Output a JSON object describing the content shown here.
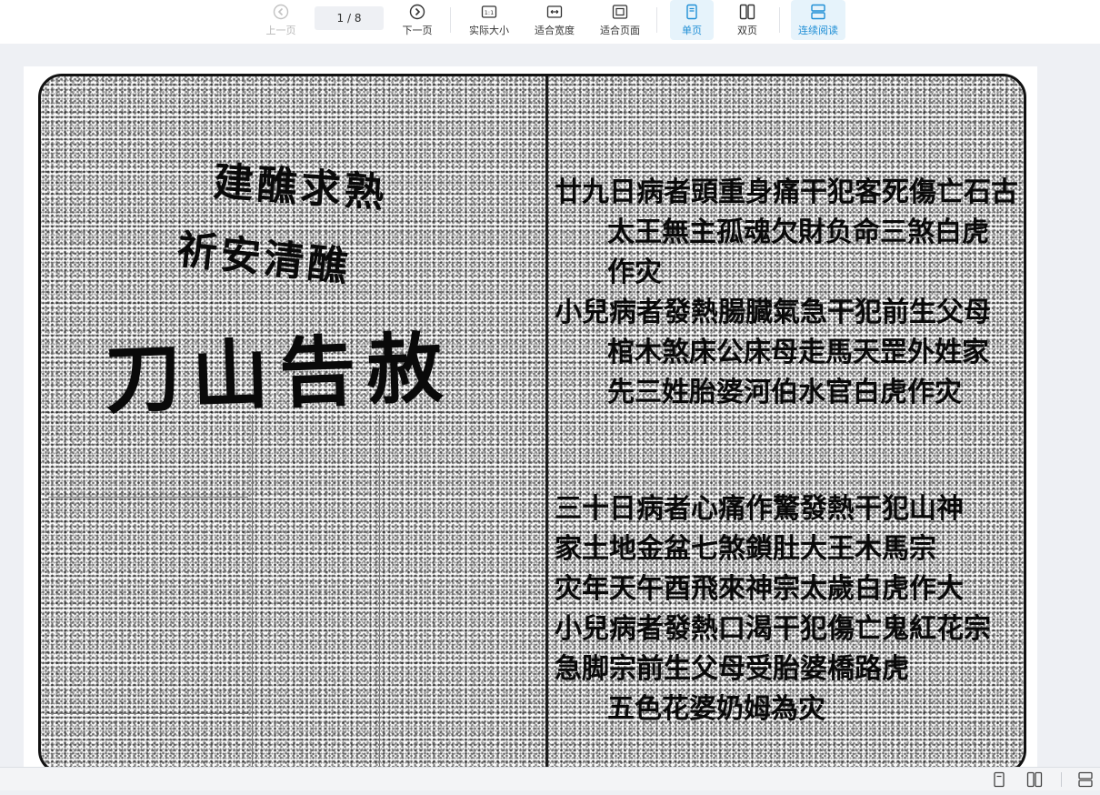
{
  "toolbar": {
    "prev": {
      "label": "上一页",
      "icon": "circle-chevron-left-icon",
      "enabled": false
    },
    "page_indicator": "1 / 8",
    "next": {
      "label": "下一页",
      "icon": "circle-chevron-right-icon"
    },
    "actual_size": {
      "label": "实际大小",
      "icon": "one-to-one-icon",
      "icon_text": "1:1"
    },
    "fit_width": {
      "label": "适合宽度",
      "icon": "fit-width-icon"
    },
    "fit_page": {
      "label": "适合页面",
      "icon": "fit-page-icon"
    },
    "single_page": {
      "label": "单页",
      "icon": "single-page-icon",
      "active": true
    },
    "double_page": {
      "label": "双页",
      "icon": "double-page-icon"
    },
    "continuous": {
      "label": "连续阅读",
      "icon": "continuous-read-icon",
      "active": true
    },
    "accent_color": "#1f8fd6"
  },
  "document": {
    "left_page": {
      "title_line1": "建醮求熟",
      "title_line2": "祈安清醮",
      "title_main": "刀山告赦"
    },
    "right_page": {
      "lines": [
        "廿九日病者頭重身痛干犯客死傷亡石古",
        "太王無主孤魂欠財负命三煞白虎",
        "作灾",
        "小兒病者發熱腸臓氣急干犯前生父母",
        "棺木煞床公床母走馬天罡外姓家",
        "先三姓胎婆河伯水官白虎作灾",
        "三十日病者心痛作驚發熱干犯山神",
        "家土地金盆七煞鎖肚大王木馬宗",
        "灾年天午酉飛來神宗太歲白虎作大",
        "小兒病者發熱口渴干犯傷亡鬼紅花宗",
        "急脚宗前生父母受胎婆橋路虎",
        "五色花婆奶姆為灾"
      ]
    }
  },
  "statusbar": {
    "icons": [
      "single-page-icon",
      "double-page-icon",
      "continuous-read-icon"
    ]
  }
}
